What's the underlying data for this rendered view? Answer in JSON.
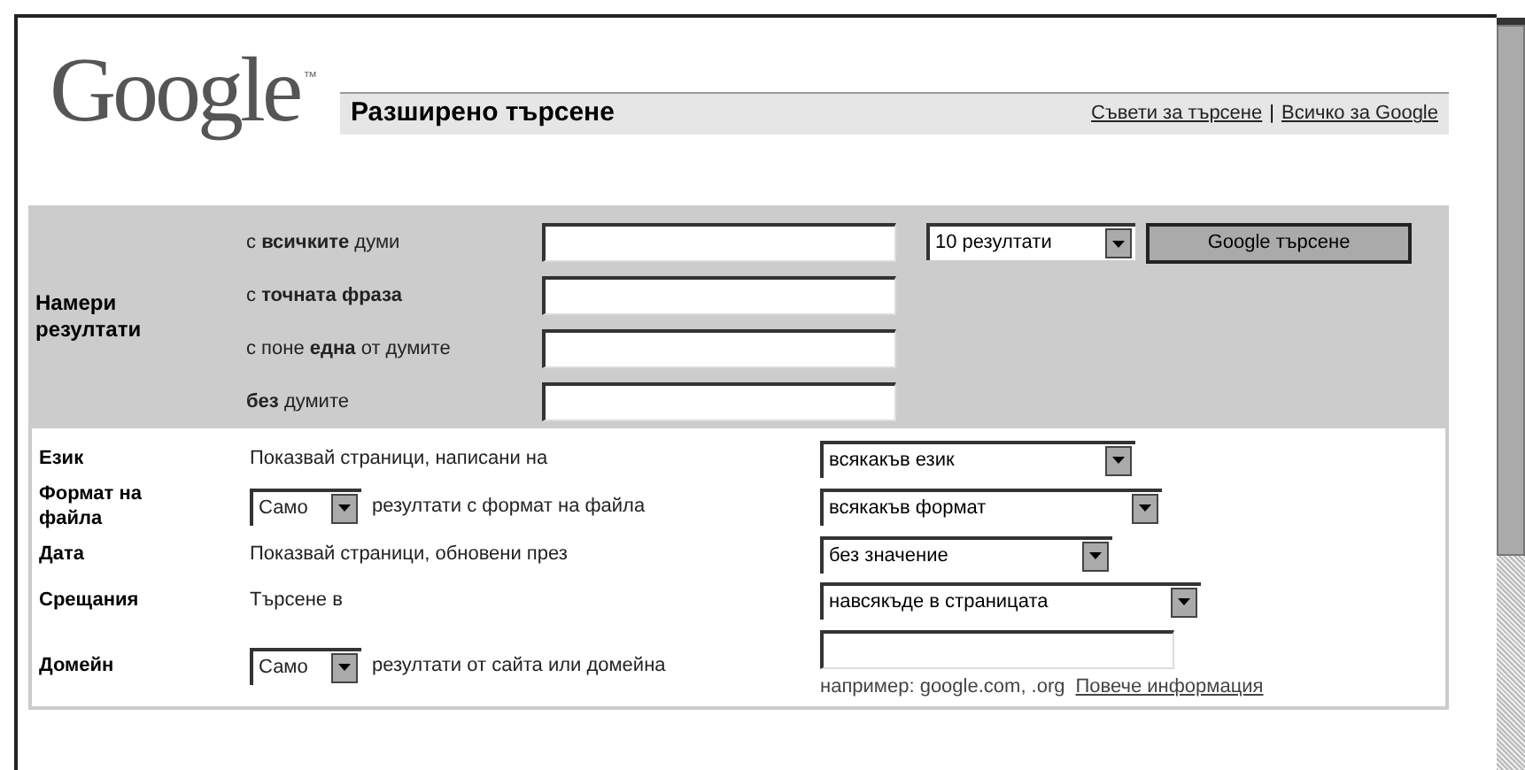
{
  "logo": {
    "text": "Google",
    "mark": "™"
  },
  "title": "Разширено търсене",
  "header_links": [
    {
      "text": "Съвети за търсене"
    },
    {
      "text": "Всичко за Google"
    }
  ],
  "header_separator": "|",
  "find_section": {
    "label": "Намери резултати",
    "rows": [
      {
        "label": "с **всичките** думи"
      },
      {
        "label": "с **точната фраза**"
      },
      {
        "label": "с поне **една** от думите"
      },
      {
        "label": "**без** думите"
      }
    ],
    "results_select": {
      "value": "10 резултати"
    },
    "search_button": "Google търсене"
  },
  "options": [
    {
      "kind": "text",
      "label": "Език",
      "text": "Показвай страници, написани на",
      "select": {
        "value": "всякакъв език"
      }
    },
    {
      "kind": "select_text",
      "label": "Формат на файла",
      "mode": "Само",
      "text": "резултати с формат на файла",
      "select": {
        "value": "всякакъв формат"
      }
    },
    {
      "kind": "text",
      "label": "Дата",
      "text": "Показвай страници, обновени през",
      "select": {
        "value": "без значение"
      }
    },
    {
      "kind": "text",
      "label": "Срещания",
      "text": "Търсене в",
      "select": {
        "value": "навсякъде в страницата"
      }
    },
    {
      "kind": "domain",
      "label": "Домейн",
      "mode": "Само",
      "text": "резултати от сайта или домейна",
      "hint": "например: google.com, .org",
      "link": "Повече информация"
    }
  ]
}
